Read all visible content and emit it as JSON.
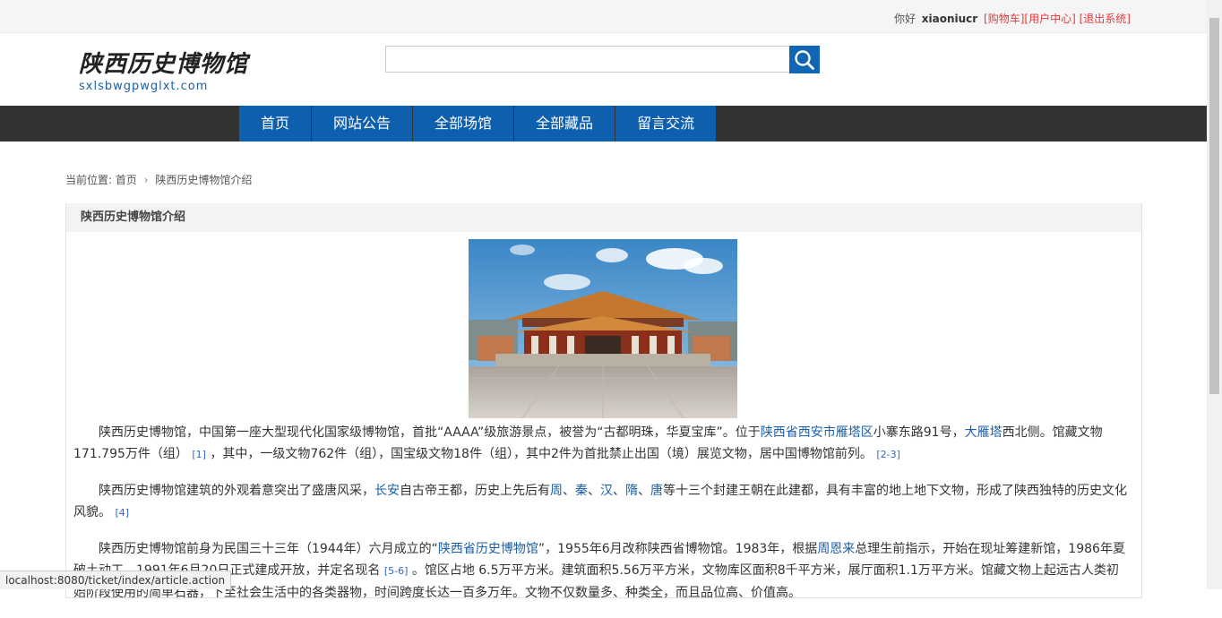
{
  "topbar": {
    "greeting": "你好",
    "username": "xiaoniucr",
    "cart": "[购物车]",
    "user_center": "[用户中心]",
    "logout": "[退出系统]"
  },
  "logo": {
    "title": "陕西历史博物馆",
    "url": "sxlsbwgpwglxt.com"
  },
  "search": {
    "value": "",
    "icon": "search-icon"
  },
  "nav": {
    "items": [
      "首页",
      "网站公告",
      "全部场馆",
      "全部藏品",
      "留言交流"
    ]
  },
  "breadcrumb": {
    "prefix": "当前位置:",
    "home": "首页",
    "separator": "›",
    "current": "陕西历史博物馆介绍"
  },
  "panel": {
    "title": "陕西历史博物馆介绍"
  },
  "article": {
    "p1": {
      "t1": "陕西历史博物馆，中国第一座大型现代化国家级博物馆，首批“AAAA”级旅游景点，被誉为“古都明珠，华夏宝库”。位于",
      "l1": "陕西省西安市雁塔区",
      "t2": "小寨东路91号，",
      "l2": "大雁塔",
      "t3": "西北侧。馆藏文物171.795万件（组）",
      "r1": "[1]",
      "t4": "，其中，一级文物762件（组），国宝级文物18件（组），其中2件为首批禁止出国（境）展览文物，居中国博物馆前列。",
      "r2": "[2-3]"
    },
    "p2": {
      "t1": "陕西历史博物馆建筑的外观着意突出了盛唐风采，",
      "l1": "长安",
      "t2": "自古帝王都，历史上先后有",
      "l2": "周",
      "s1": "、",
      "l3": "秦",
      "s2": "、",
      "l4": "汉",
      "s3": "、",
      "l5": "隋",
      "s4": "、",
      "l6": "唐",
      "t3": "等十三个封建王朝在此建都，具有丰富的地上地下文物，形成了陕西独特的历史文化风貌。",
      "r1": "[4]"
    },
    "p3": {
      "t1": "陕西历史博物馆前身为民国三十三年（1944年）六月成立的“",
      "l1": "陕西省历史博物馆",
      "t2": "”，1955年6月改称陕西省博物馆。1983年，根据",
      "l2": "周恩来",
      "t3": "总理生前指示，开始在现址筹建新馆，1986年夏破土动工，1991年6月20日正式建成开放，并定名现名",
      "r1": "[5-6]",
      "t4": "。馆区占地 6.5万平方米。建筑面积5.56万平方米，文物库区面积8千平方米，展厅面积1.1万平方米。馆藏文物上起远古人类初始阶段使用的简单石器，下至社会生活中的各类器物，时间跨度长达一百多万年。文物不仅数量多、种类全，而且品位高、价值高。"
    }
  },
  "status_url": "localhost:8080/ticket/index/article.action",
  "colors": {
    "nav_bg": "#333333",
    "nav_item": "#0e5fae",
    "accent_link": "#1a5fa8",
    "topbar_link": "#e03c3c"
  }
}
